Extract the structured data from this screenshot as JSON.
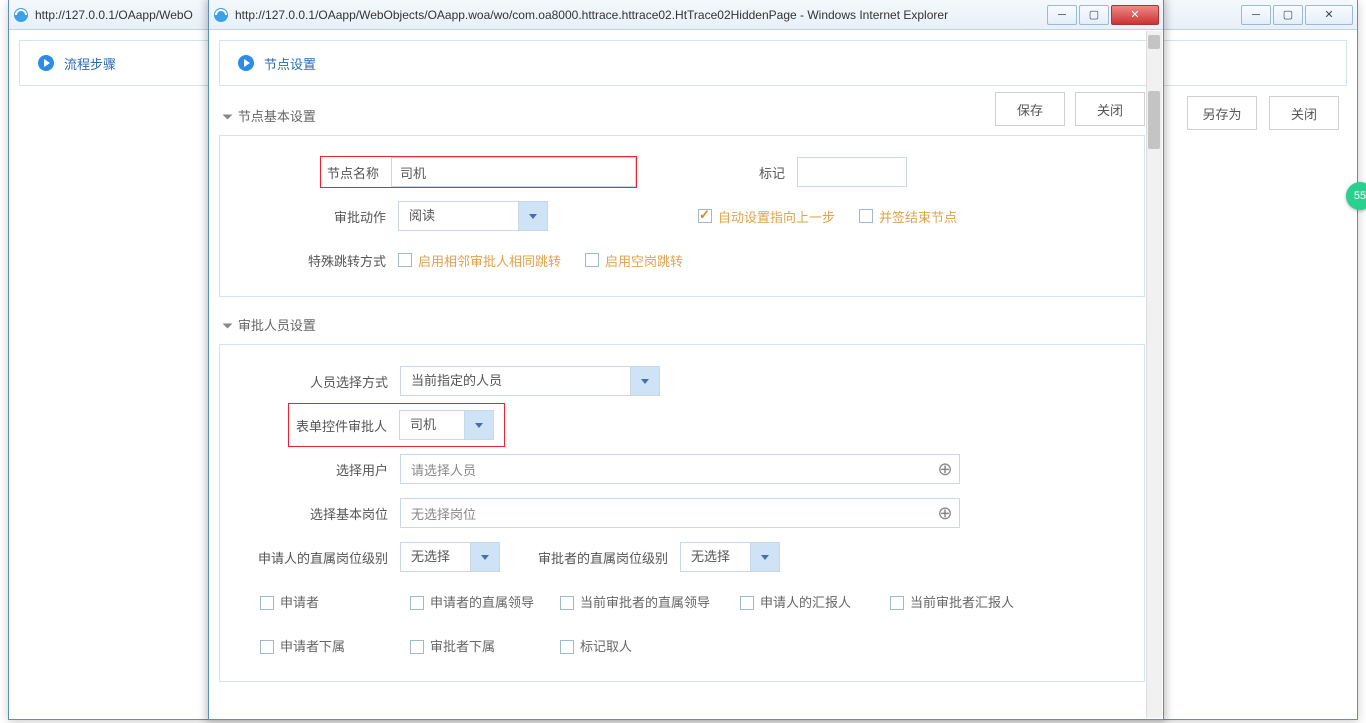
{
  "back_window": {
    "title_prefix": "http://127.0.0.1/OAapp/WebO",
    "panel_title": "流程步骤",
    "buttons": {
      "save_as": "另存为",
      "close": "关闭"
    }
  },
  "front_window": {
    "url": "http://127.0.0.1/OAapp/WebObjects/OAapp.woa/wo/com.oa8000.httrace.httrace02.HtTrace02HiddenPage - Windows Internet Explorer",
    "panel_title": "节点设置",
    "toolbar": {
      "save": "保存",
      "close": "关闭"
    }
  },
  "section_basic": {
    "title": "节点基本设置",
    "node_name_label": "节点名称",
    "node_name_value": "司机",
    "mark_label": "标记",
    "mark_value": "",
    "approve_action_label": "审批动作",
    "approve_action_value": "阅读",
    "auto_prev_label": "自动设置指向上一步",
    "auto_prev_checked": true,
    "end_node_label": "并签结束节点",
    "end_node_checked": false,
    "jump_label": "特殊跳转方式",
    "jump_adjacent_label": "启用相邻审批人相同跳转",
    "jump_empty_label": "启用空岗跳转"
  },
  "section_people": {
    "title": "审批人员设置",
    "select_mode_label": "人员选择方式",
    "select_mode_value": "当前指定的人员",
    "form_approver_label": "表单控件审批人",
    "form_approver_value": "司机",
    "select_user_label": "选择用户",
    "select_user_placeholder": "请选择人员",
    "select_post_label": "选择基本岗位",
    "select_post_placeholder": "无选择岗位",
    "applicant_rank_label": "申请人的直属岗位级别",
    "applicant_rank_value": "无选择",
    "approver_rank_label": "审批者的直属岗位级别",
    "approver_rank_value": "无选择",
    "checks": {
      "applicant": "申请者",
      "applicant_leader": "申请者的直属领导",
      "current_approver_leader": "当前审批者的直属领导",
      "applicant_reporter": "申请人的汇报人",
      "current_approver_reporter": "当前审批者汇报人",
      "applicant_sub": "申请者下属",
      "approver_sub": "审批者下属",
      "marker": "标记取人"
    }
  },
  "side_badge": "55"
}
